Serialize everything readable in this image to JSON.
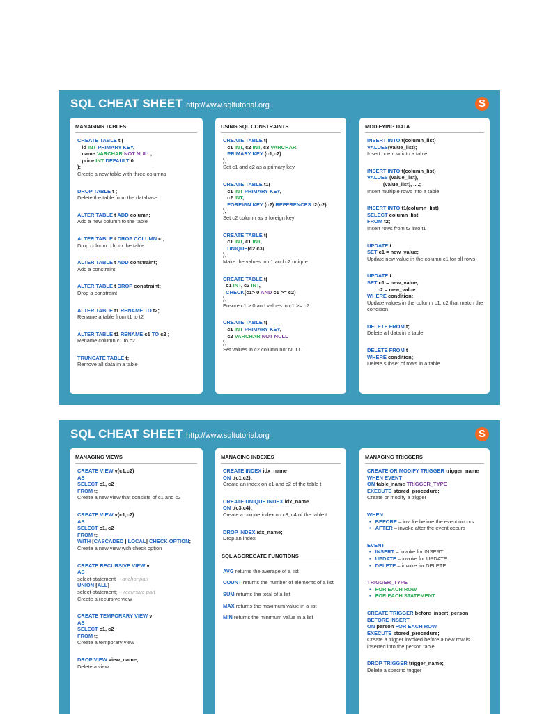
{
  "sheet_title": "SQL CHEAT SHEET",
  "sheet_url": "http://www.sqltutorial.org",
  "logo_letter": "S",
  "colors": {
    "background": "#3f9bbb",
    "keyword": "#1e64bf",
    "type": "#2aa84f",
    "purple": "#7a3f9d",
    "logo": "#f26a22"
  },
  "sheet1": {
    "tables": {
      "title": "MANAGING TABLES",
      "entries": [
        {
          "code": "CREATE TABLE t (\n   id INT PRIMARY KEY,\n   name VARCHAR NOT NULL,\n   price INT DEFAULT 0\n);",
          "desc": "Create a new table with three columns"
        },
        {
          "code": "DROP TABLE t ;",
          "desc": "Delete the table from the database"
        },
        {
          "code": "ALTER TABLE t ADD column;",
          "desc": "Add a new column to the table"
        },
        {
          "code": "ALTER TABLE t DROP COLUMN c ;",
          "desc": "Drop column c from the table"
        },
        {
          "code": "ALTER TABLE t ADD constraint;",
          "desc": "Add a constraint"
        },
        {
          "code": "ALTER TABLE t DROP constraint;",
          "desc": "Drop a constraint"
        },
        {
          "code": "ALTER TABLE t1 RENAME TO t2;",
          "desc": "Rename a table from t1 to t2"
        },
        {
          "code": "ALTER TABLE t1 RENAME c1 TO c2 ;",
          "desc": "Rename column c1 to c2"
        },
        {
          "code": "TRUNCATE TABLE t;",
          "desc": "Remove all data in a table"
        }
      ]
    },
    "constraints": {
      "title": "USING SQL CONSTRAINTS",
      "entries": [
        {
          "code": "CREATE TABLE t(\n   c1 INT, c2 INT, c3 VARCHAR,\n   PRIMARY KEY (c1,c2)\n);",
          "desc": "Set c1 and c2 as a primary key"
        },
        {
          "code": "CREATE TABLE t1(\n   c1 INT PRIMARY KEY,\n   c2 INT,\n   FOREIGN KEY (c2) REFERENCES t2(c2)\n);",
          "desc": "Set c2 column as a foreign key"
        },
        {
          "code": "CREATE TABLE t(\n   c1 INT, c1 INT,\n   UNIQUE(c2,c3)\n);",
          "desc": "Make the values in c1 and c2 unique"
        },
        {
          "code": "CREATE TABLE t(\n  c1 INT, c2 INT,\n  CHECK(c1> 0 AND c1 >= c2)\n);",
          "desc": "Ensure c1 > 0 and values in c1 >= c2"
        },
        {
          "code": "CREATE TABLE t(\n   c1 INT PRIMARY KEY,\n   c2 VARCHAR NOT NULL\n);",
          "desc": "Set values in c2 column not NULL"
        }
      ]
    },
    "modifying": {
      "title": "MODIFYING DATA",
      "entries": [
        {
          "code": "INSERT INTO t(column_list)\nVALUES(value_list);",
          "desc": "Insert one row into a table"
        },
        {
          "code": "INSERT INTO t(column_list)\nVALUES (value_list),\n           (value_list), ....;",
          "desc": "Insert multiple rows into a table"
        },
        {
          "code": "INSERT INTO t1(column_list)\nSELECT column_list\nFROM t2;",
          "desc": "Insert rows from t2 into t1"
        },
        {
          "code": "UPDATE t\nSET c1 = new_value;",
          "desc": "Update new value in the column c1 for all rows"
        },
        {
          "code": "UPDATE t\nSET c1 = new_value,\n       c2 = new_value\nWHERE condition;",
          "desc": "Update values in the column c1, c2 that match the condition"
        },
        {
          "code": "DELETE FROM t;",
          "desc": "Delete all data in a table"
        },
        {
          "code": "DELETE FROM t\nWHERE condition;",
          "desc": "Delete subset of rows in a table"
        }
      ]
    }
  },
  "sheet2": {
    "views": {
      "title": "MANAGING VIEWS",
      "entries": [
        {
          "code": "CREATE VIEW v(c1,c2)\nAS\nSELECT c1, c2\nFROM t;",
          "desc": "Create a new view that consists  of c1 and c2"
        },
        {
          "code": "CREATE VIEW v(c1,c2)\nAS\nSELECT c1, c2\nFROM t;\nWITH [CASCADED | LOCAL] CHECK OPTION;",
          "desc": "Create a new view with check option"
        },
        {
          "code": "CREATE RECURSIVE VIEW v\nAS",
          "lines": [
            {
              "text": "select-statement",
              "note": " -- anchor part"
            },
            {
              "text": "UNION [ALL]",
              "bold": true
            },
            {
              "text": "select-statement;",
              "note": " -- recursive part"
            }
          ],
          "desc": "Create a recursive view"
        },
        {
          "code": "CREATE TEMPORARY VIEW v\nAS\nSELECT c1, c2\nFROM t;",
          "desc": "Create a temporary view"
        },
        {
          "code": "DROP VIEW view_name;",
          "desc": "Delete a view"
        }
      ]
    },
    "indexes": {
      "title": "MANAGING INDEXES",
      "entries": [
        {
          "code": "CREATE INDEX idx_name\nON t(c1,c2);",
          "desc": "Create an index on c1 and c2 of the table t"
        },
        {
          "code": "CREATE UNIQUE INDEX idx_name\nON t(c3,c4);",
          "desc": "Create a unique index on c3, c4 of the table t"
        },
        {
          "code": "DROP INDEX idx_name;",
          "desc": "Drop an index"
        }
      ],
      "aggregate_title": "SQL AGGREGATE FUNCTIONS",
      "aggregates": [
        {
          "fn": "AVG",
          "desc": " returns the average of a list"
        },
        {
          "fn": "COUNT",
          "desc": " returns the number of elements of a list"
        },
        {
          "fn": "SUM",
          "desc": " returns the total of a list"
        },
        {
          "fn": "MAX",
          "desc": " returns the maximum value in a list"
        },
        {
          "fn": "MIN",
          "desc": " returns the minimum  value in a list"
        }
      ]
    },
    "triggers": {
      "title": "MANAGING TRIGGERS",
      "entries": [
        {
          "code": "CREATE OR MODIFY TRIGGER trigger_name\nWHEN EVENT\nON table_name TRIGGER_TYPE\nEXECUTE stored_procedure;",
          "desc": "Create or modify a trigger"
        },
        {
          "code": "WHEN",
          "bullets": [
            {
              "kw": "BEFORE",
              "text": " – invoke before the event occurs"
            },
            {
              "kw": "AFTER",
              "text": " – invoke after the event occurs"
            }
          ]
        },
        {
          "code": "EVENT",
          "bullets": [
            {
              "kw": "INSERT",
              "text": " – invoke for INSERT"
            },
            {
              "kw": "UPDATE",
              "text": " – invoke for UPDATE"
            },
            {
              "kw": "DELETE",
              "text": " – invoke for DELETE"
            }
          ]
        },
        {
          "code": "TRIGGER_TYPE",
          "bullets": [
            {
              "kw": "FOR EACH ROW",
              "text": ""
            },
            {
              "kw": "FOR EACH STATEMENT",
              "text": ""
            }
          ]
        },
        {
          "code": "CREATE TRIGGER before_insert_person\nBEFORE INSERT\nON person FOR EACH ROW\nEXECUTE stored_procedure;",
          "desc": "Create a trigger invoked  before a new row is inserted into the person table"
        },
        {
          "code": "DROP TRIGGER trigger_name;",
          "desc": "Delete a specific trigger"
        }
      ]
    }
  }
}
